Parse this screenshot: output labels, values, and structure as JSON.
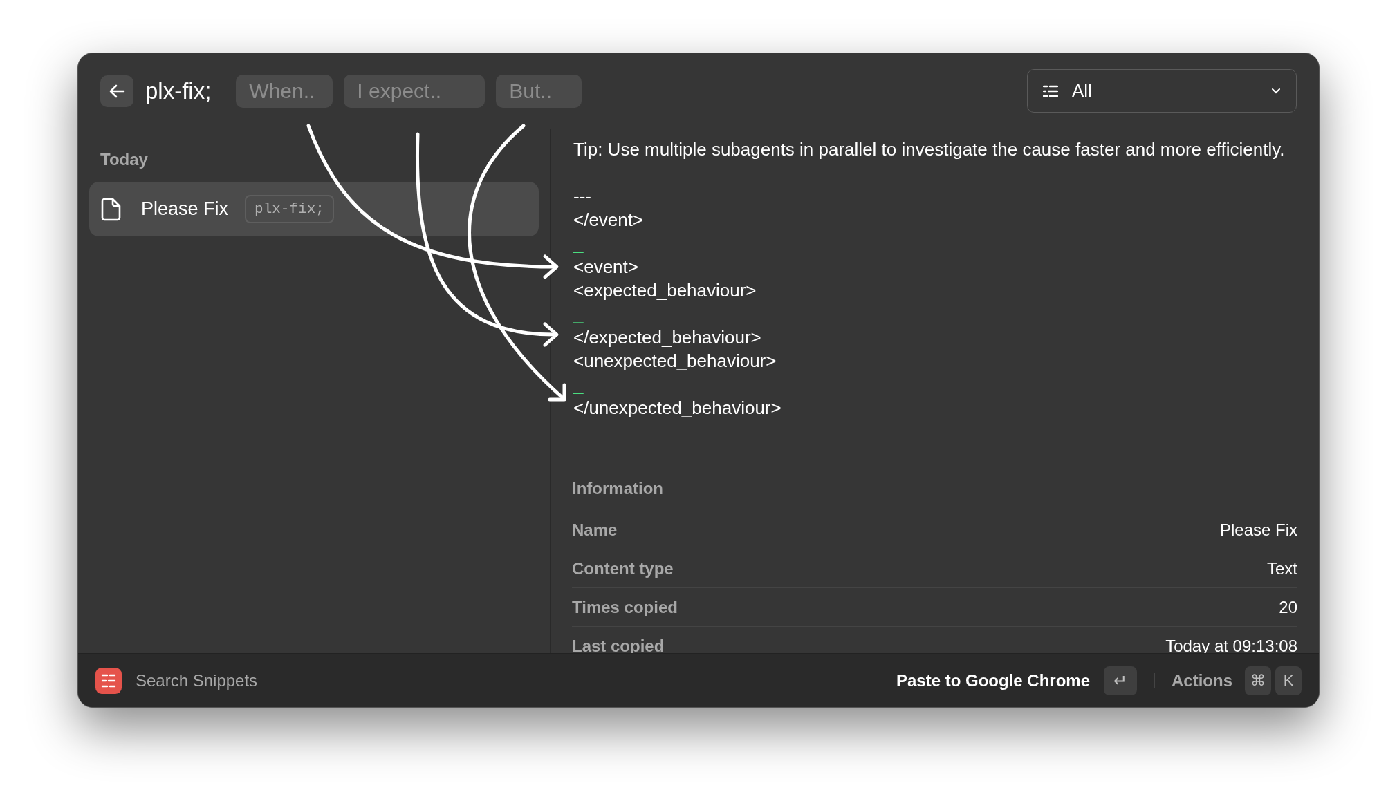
{
  "header": {
    "keyword": "plx-fix;",
    "arguments": [
      {
        "placeholder": "When.."
      },
      {
        "placeholder": "I expect.."
      },
      {
        "placeholder": "But.."
      }
    ],
    "filter": {
      "value": "All"
    }
  },
  "sidebar": {
    "section": "Today",
    "items": [
      {
        "title": "Please Fix",
        "keyword": "plx-fix;",
        "selected": true
      }
    ]
  },
  "preview": {
    "lines": [
      {
        "kind": "text",
        "text": "Tip: Use multiple subagents in parallel to investigate the cause faster and more efficiently."
      },
      {
        "kind": "rule",
        "text": "---"
      },
      {
        "kind": "text",
        "text": "</event>"
      },
      {
        "kind": "cursor",
        "text": "_"
      },
      {
        "kind": "text",
        "text": "<event>"
      },
      {
        "kind": "text",
        "text": "<expected_behaviour>"
      },
      {
        "kind": "cursor",
        "text": "_"
      },
      {
        "kind": "text",
        "text": "</expected_behaviour>"
      },
      {
        "kind": "text",
        "text": "<unexpected_behaviour>"
      },
      {
        "kind": "cursor",
        "text": "_"
      },
      {
        "kind": "text",
        "text": "</unexpected_behaviour>"
      }
    ]
  },
  "information": {
    "title": "Information",
    "rows": [
      {
        "label": "Name",
        "value": "Please Fix"
      },
      {
        "label": "Content type",
        "value": "Text"
      },
      {
        "label": "Times copied",
        "value": "20"
      },
      {
        "label": "Last copied",
        "value": "Today at 09:13:08"
      }
    ]
  },
  "footer": {
    "app_name": "Search Snippets",
    "primary_action": "Paste to Google Chrome",
    "primary_key": "↵",
    "secondary_action": "Actions",
    "secondary_keys": [
      "⌘",
      "K"
    ]
  }
}
